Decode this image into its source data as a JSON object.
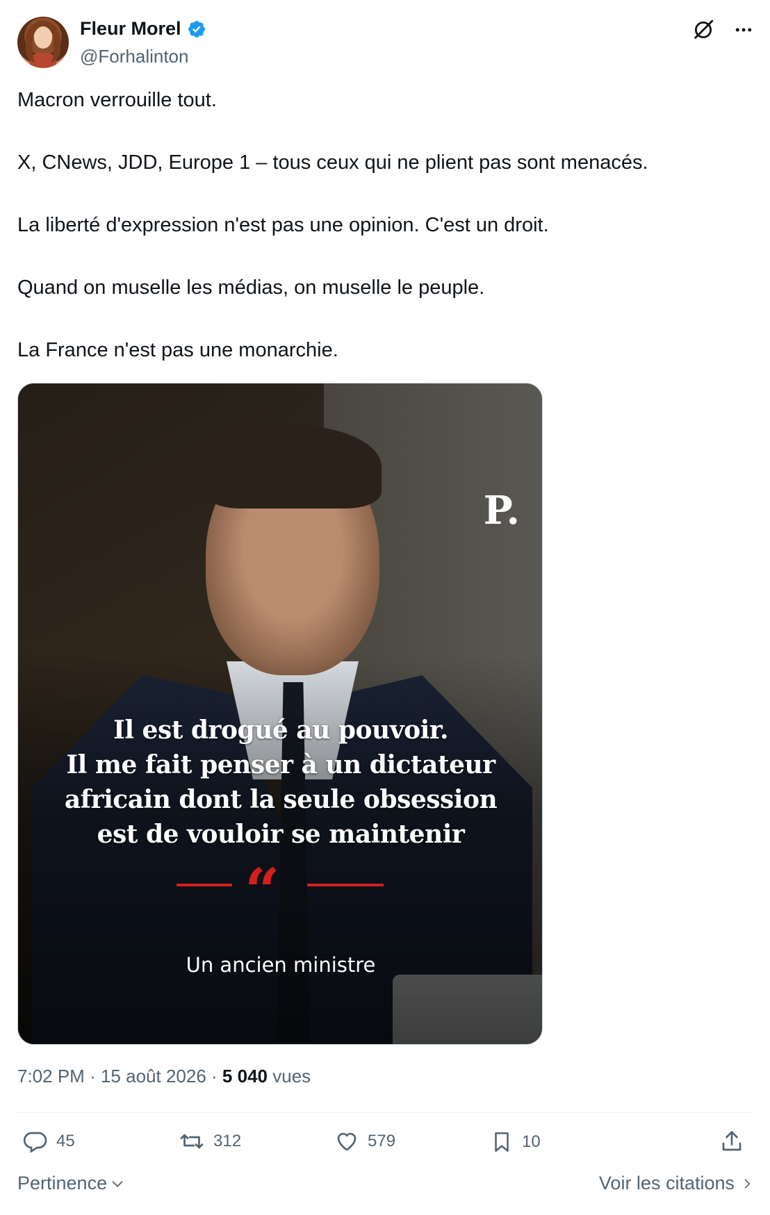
{
  "author": {
    "display_name": "Fleur Morel",
    "handle": "@Forhalinton",
    "verified": true
  },
  "tweet": {
    "paragraphs": [
      "Macron verrouille tout.",
      "X, CNews, JDD, Europe 1 – tous ceux qui ne plient pas sont menacés.",
      "La liberté d'expression n'est pas une opinion. C'est un droit.",
      "Quand on muselle les médias, on muselle le peuple.",
      "La France n'est pas une monarchie."
    ]
  },
  "media": {
    "logo": "P.",
    "quote_lines": [
      "Il est drogué au pouvoir.",
      "Il me fait penser à un dictateur",
      "africain dont la seule obsession",
      "est de vouloir se maintenir"
    ],
    "quote_mark": "“",
    "attribution": "Un ancien ministre",
    "accent_color": "#d41f1f"
  },
  "meta": {
    "time": "7:02 PM",
    "separator": "·",
    "date": "15 août 2026",
    "views_count": "5 040",
    "views_label": "vues"
  },
  "actions": {
    "replies": "45",
    "reposts": "312",
    "likes": "579",
    "bookmarks": "10"
  },
  "footer": {
    "sort_label": "Pertinence",
    "quotes_label": "Voir les citations"
  },
  "colors": {
    "text_primary": "#0f1419",
    "text_secondary": "#536471",
    "verified_blue": "#1d9bf0",
    "divider": "#eff3f4"
  },
  "icons": {
    "grok": "grok-icon",
    "more": "more-icon",
    "reply": "reply-icon",
    "repost": "repost-icon",
    "like": "like-icon",
    "bookmark": "bookmark-icon",
    "share": "share-icon",
    "chevron_down": "chevron-down-icon",
    "chevron_right": "chevron-right-icon",
    "verified": "verified-badge-icon"
  }
}
